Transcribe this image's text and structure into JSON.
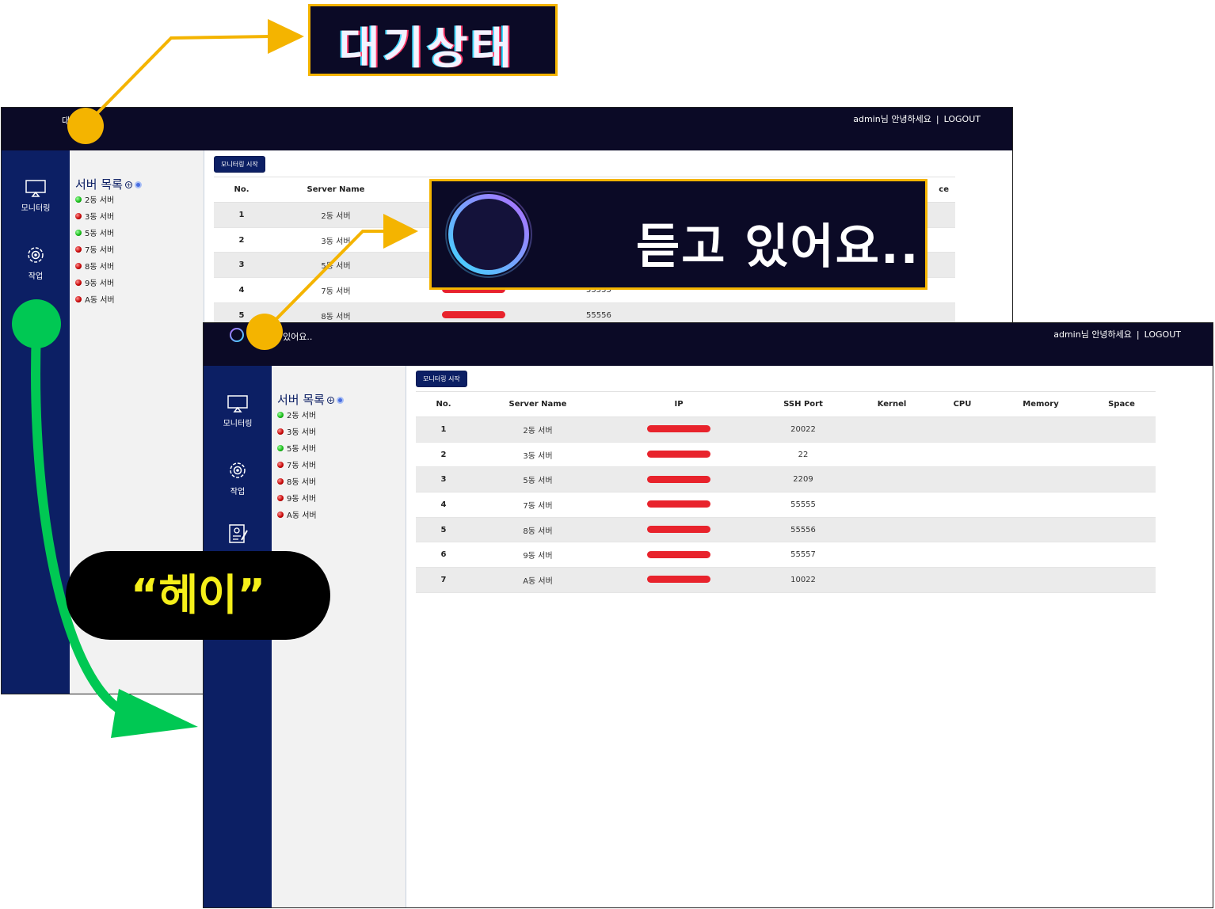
{
  "callouts": {
    "standby_text": "대기상태",
    "listening_text": "듣고 있어요..",
    "hey_text": "“헤이”"
  },
  "back_window": {
    "status_text": "대",
    "user": {
      "greeting": "admin님 안녕하세요",
      "separator": "|",
      "logout": "LOGOUT"
    },
    "rail": {
      "monitor_label": "모니터링",
      "task_label": "작업"
    },
    "panel": {
      "title": "서버 목록",
      "servers": [
        {
          "label": "2동 서버",
          "status": "green"
        },
        {
          "label": "3동 서버",
          "status": "red"
        },
        {
          "label": "5동 서버",
          "status": "green"
        },
        {
          "label": "7동 서버",
          "status": "red"
        },
        {
          "label": "8동 서버",
          "status": "red"
        },
        {
          "label": "9동 서버",
          "status": "red"
        },
        {
          "label": "A동 서버",
          "status": "red"
        }
      ]
    },
    "monitor_button": "모니터링 시작",
    "table": {
      "headers": [
        "No.",
        "Server Name",
        "ce"
      ],
      "rows": [
        {
          "no": "1",
          "name": "2동 서버",
          "port": ""
        },
        {
          "no": "2",
          "name": "3동 서버",
          "port": ""
        },
        {
          "no": "3",
          "name": "5동 서버",
          "port": ""
        },
        {
          "no": "4",
          "name": "7동 서버",
          "port": "55555"
        },
        {
          "no": "5",
          "name": "8동 서버",
          "port": "55556"
        }
      ]
    }
  },
  "front_window": {
    "status_text": "있어요..",
    "user": {
      "greeting": "admin님 안녕하세요",
      "separator": "|",
      "logout": "LOGOUT"
    },
    "rail": {
      "monitor_label": "모니터링",
      "task_label": "작업"
    },
    "panel": {
      "title": "서버 목록",
      "servers": [
        {
          "label": "2동 서버",
          "status": "green"
        },
        {
          "label": "3동 서버",
          "status": "red"
        },
        {
          "label": "5동 서버",
          "status": "green"
        },
        {
          "label": "7동 서버",
          "status": "red"
        },
        {
          "label": "8동 서버",
          "status": "red"
        },
        {
          "label": "9동 서버",
          "status": "red"
        },
        {
          "label": "A동 서버",
          "status": "red"
        }
      ]
    },
    "monitor_button": "모니터링 시작",
    "table": {
      "headers": [
        "No.",
        "Server Name",
        "IP",
        "SSH Port",
        "Kernel",
        "CPU",
        "Memory",
        "Space"
      ],
      "rows": [
        {
          "no": "1",
          "name": "2동 서버",
          "port": "20022"
        },
        {
          "no": "2",
          "name": "3동 서버",
          "port": "22"
        },
        {
          "no": "3",
          "name": "5동 서버",
          "port": "2209"
        },
        {
          "no": "4",
          "name": "7동 서버",
          "port": "55555"
        },
        {
          "no": "5",
          "name": "8동 서버",
          "port": "55556"
        },
        {
          "no": "6",
          "name": "9동 서버",
          "port": "55557"
        },
        {
          "no": "7",
          "name": "A동 서버",
          "port": "10022"
        }
      ]
    }
  },
  "colors": {
    "header_bg": "#0b0a26",
    "rail_bg": "#0c1f64",
    "callout_border": "#f4b400",
    "green_marker": "#00c853",
    "redaction": "#e8232c",
    "hey_text": "#f5ef1a"
  }
}
